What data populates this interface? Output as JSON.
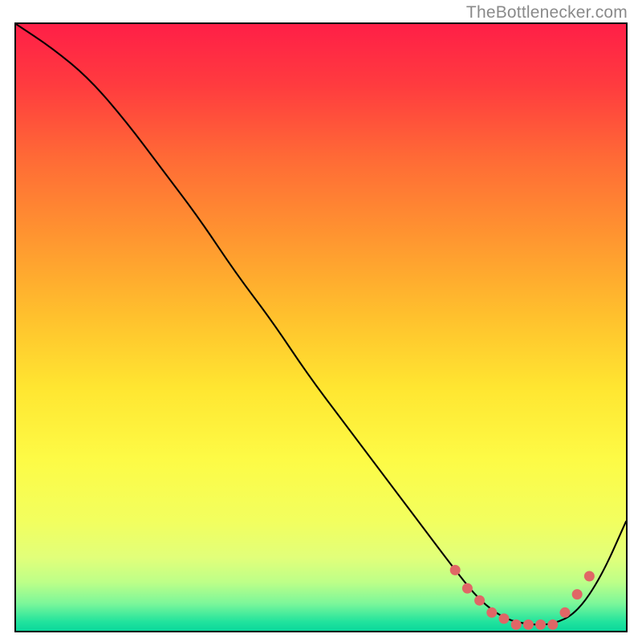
{
  "watermark": "TheBottlenecker.com",
  "chart_data": {
    "type": "line",
    "title": "",
    "xlabel": "",
    "ylabel": "",
    "xlim": [
      0,
      100
    ],
    "ylim": [
      0,
      100
    ],
    "background": {
      "gradient_stops": [
        {
          "offset": 0.0,
          "color": "#ff1f47"
        },
        {
          "offset": 0.1,
          "color": "#ff3b3f"
        },
        {
          "offset": 0.22,
          "color": "#ff6a36"
        },
        {
          "offset": 0.35,
          "color": "#ff9530"
        },
        {
          "offset": 0.48,
          "color": "#ffc02d"
        },
        {
          "offset": 0.6,
          "color": "#ffe631"
        },
        {
          "offset": 0.72,
          "color": "#fdfb46"
        },
        {
          "offset": 0.82,
          "color": "#f2ff5f"
        },
        {
          "offset": 0.88,
          "color": "#e1ff7a"
        },
        {
          "offset": 0.92,
          "color": "#bdff88"
        },
        {
          "offset": 0.955,
          "color": "#7cf79a"
        },
        {
          "offset": 0.985,
          "color": "#22e39d"
        },
        {
          "offset": 1.0,
          "color": "#0bd89c"
        }
      ]
    },
    "series": [
      {
        "name": "bottleneck-curve",
        "x": [
          0,
          6,
          12,
          18,
          24,
          30,
          36,
          42,
          48,
          54,
          60,
          66,
          72,
          76,
          80,
          84,
          88,
          92,
          96,
          100
        ],
        "y": [
          100,
          96,
          91,
          84,
          76,
          68,
          59,
          51,
          42,
          34,
          26,
          18,
          10,
          5,
          2,
          1,
          1,
          3,
          9,
          18
        ],
        "stroke": "#000000",
        "stroke_width": 2.1
      }
    ],
    "markers": {
      "name": "highlight-points",
      "x": [
        72,
        74,
        76,
        78,
        80,
        82,
        84,
        86,
        88,
        90,
        92,
        94
      ],
      "y": [
        10,
        7,
        5,
        3,
        2,
        1,
        1,
        1,
        1,
        3,
        6,
        9
      ],
      "color": "#e06666",
      "radius": 6.5
    }
  }
}
